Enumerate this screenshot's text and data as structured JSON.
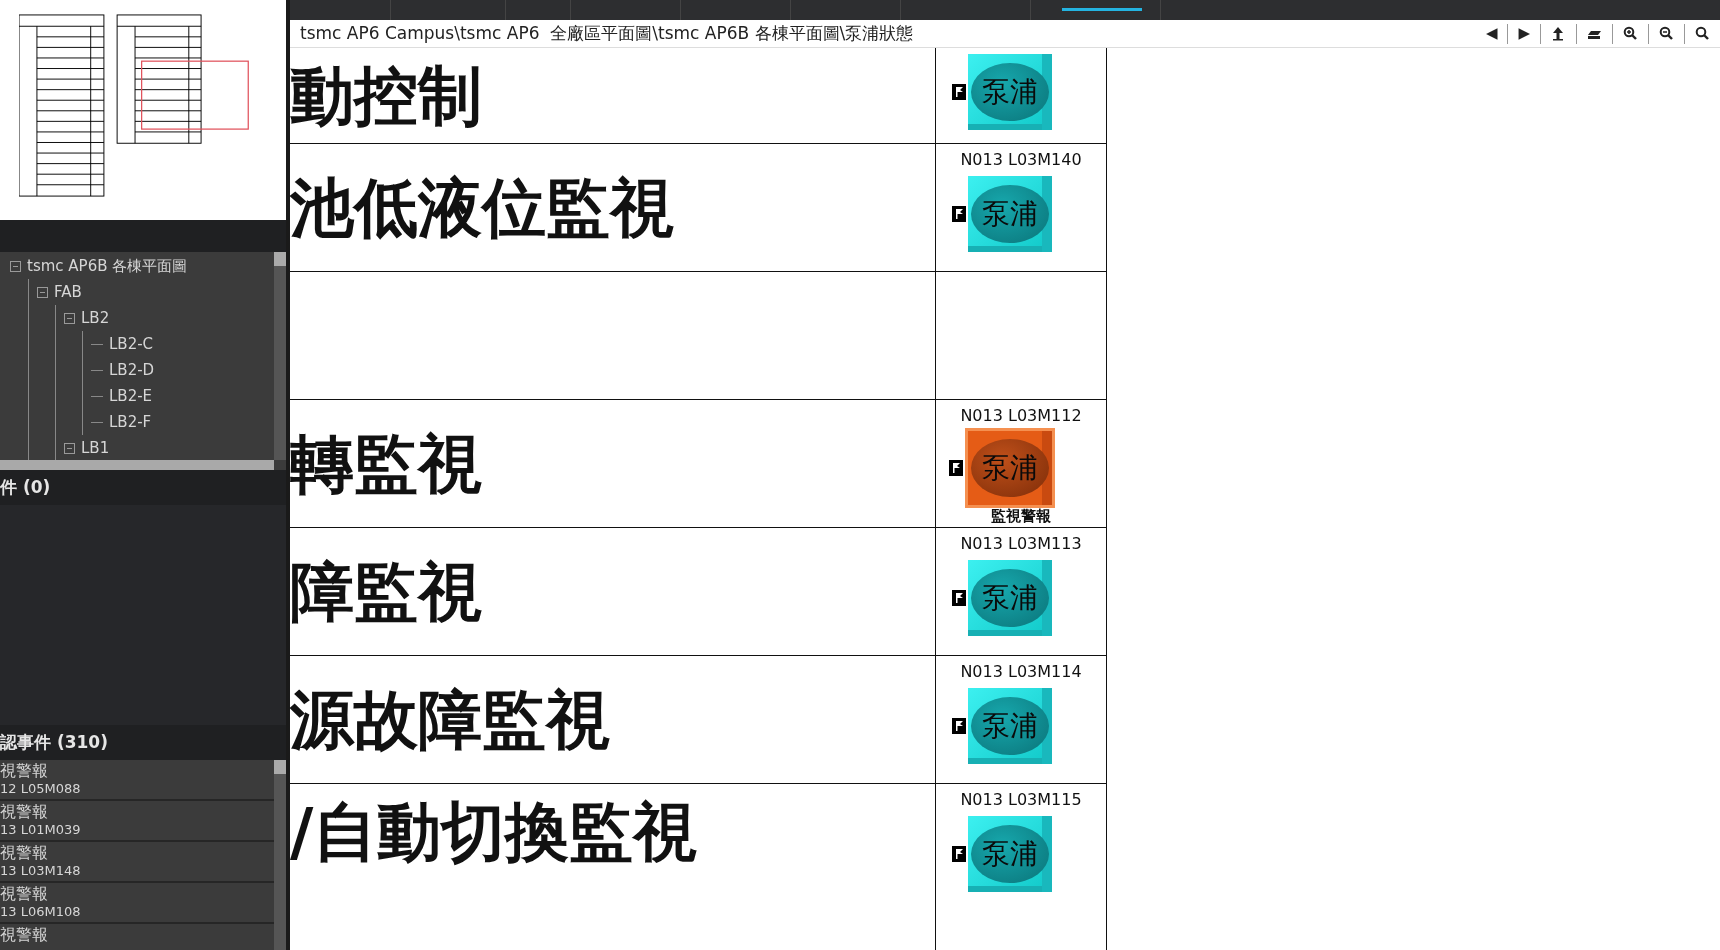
{
  "tree": [
    {
      "label": "tsmc AP6B 各棟平面圖",
      "expanded": true,
      "children": [
        {
          "label": "FAB",
          "expanded": true,
          "children": [
            {
              "label": "LB2",
              "expanded": true,
              "children": [
                {
                  "label": "LB2-C"
                },
                {
                  "label": "LB2-D"
                },
                {
                  "label": "LB2-E"
                },
                {
                  "label": "LB2-F"
                }
              ]
            },
            {
              "label": "LB1",
              "expanded": true
            }
          ]
        }
      ]
    }
  ],
  "alarm_panel": {
    "title": "件 (0)"
  },
  "event_panel": {
    "title": "認事件 (310)",
    "items": [
      {
        "title": "視警報",
        "code": "12 L05M088"
      },
      {
        "title": "視警報",
        "code": "13 L01M039"
      },
      {
        "title": "視警報",
        "code": "13 L03M148"
      },
      {
        "title": "視警報",
        "code": "13 L06M108"
      },
      {
        "title": "視警報"
      }
    ]
  },
  "path": "tsmc AP6 Campus\\tsmc AP6  全廠區平面圖\\tsmc AP6B 各棟平面圖\\泵浦狀態",
  "toolbar": [
    {
      "kind": "prev",
      "label": "◀"
    },
    {
      "kind": "next",
      "label": "▶"
    },
    {
      "kind": "up"
    },
    {
      "kind": "layers"
    },
    {
      "kind": "zoom_in"
    },
    {
      "kind": "zoom_out"
    },
    {
      "kind": "search"
    }
  ],
  "rows": [
    {
      "kind": "point",
      "label": "動控制",
      "pump": {
        "alarm": false,
        "text": "泵浦"
      }
    },
    {
      "kind": "point",
      "label": "池低液位監視",
      "tag": "N013 L03M140",
      "pump": {
        "alarm": false,
        "text": "泵浦"
      }
    },
    {
      "kind": "blank"
    },
    {
      "kind": "point",
      "label": "轉監視",
      "tag": "N013 L03M112",
      "pump": {
        "alarm": true,
        "text": "泵浦",
        "status_text": "監視警報"
      }
    },
    {
      "kind": "point",
      "label": "障監視",
      "tag": "N013 L03M113",
      "pump": {
        "alarm": false,
        "text": "泵浦"
      }
    },
    {
      "kind": "point",
      "label": "源故障監視",
      "tag": "N013 L03M114",
      "pump": {
        "alarm": false,
        "text": "泵浦"
      }
    },
    {
      "kind": "point",
      "label": "/自動切換監視",
      "tag": "N013 L03M115",
      "pump": {
        "alarm": false,
        "text": "泵浦"
      }
    }
  ]
}
